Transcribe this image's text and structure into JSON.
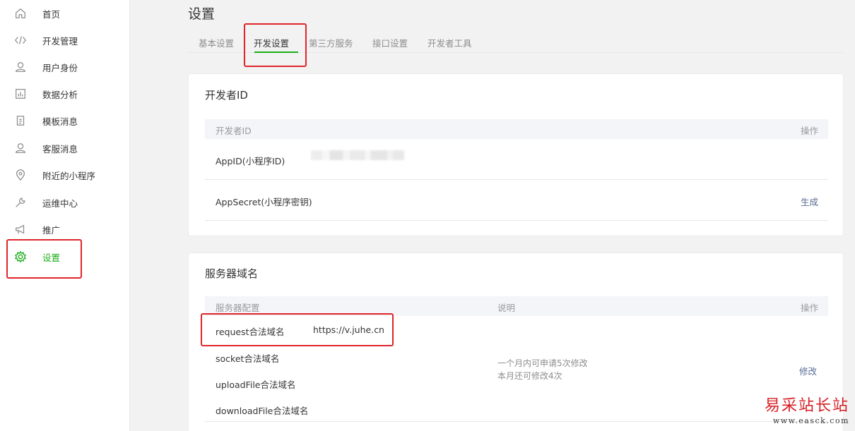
{
  "sidebar": {
    "items": [
      {
        "label": "首页",
        "icon": "home-icon"
      },
      {
        "label": "开发管理",
        "icon": "code-icon"
      },
      {
        "label": "用户身份",
        "icon": "user-icon"
      },
      {
        "label": "数据分析",
        "icon": "chart-icon"
      },
      {
        "label": "模板消息",
        "icon": "document-icon"
      },
      {
        "label": "客服消息",
        "icon": "customer-service-icon"
      },
      {
        "label": "附近的小程序",
        "icon": "location-icon"
      },
      {
        "label": "运维中心",
        "icon": "wrench-icon"
      },
      {
        "label": "推广",
        "icon": "megaphone-icon"
      },
      {
        "label": "设置",
        "icon": "gear-icon"
      }
    ],
    "active_index": 9,
    "active_color": "#1aad19"
  },
  "header": {
    "title": "设置",
    "tabs": [
      "基本设置",
      "开发设置",
      "第三方服务",
      "接口设置",
      "开发者工具"
    ],
    "active_tab": 1
  },
  "developer_card": {
    "title": "开发者ID",
    "table_header": {
      "col1": "开发者ID",
      "col_action": "操作"
    },
    "rows": [
      {
        "key": "AppID(小程序ID)",
        "value_obscured": true
      },
      {
        "key": "AppSecret(小程序密钥)",
        "action": "生成"
      }
    ]
  },
  "server_card": {
    "title": "服务器域名",
    "table_header": {
      "col1": "服务器配置",
      "col2": "说明",
      "col_action": "操作"
    },
    "rows": [
      {
        "key": "request合法域名",
        "value": "https://v.juhe.cn"
      },
      {
        "key": "socket合法域名",
        "value": ""
      },
      {
        "key": "uploadFile合法域名",
        "value": ""
      },
      {
        "key": "downloadFile合法域名",
        "value": ""
      }
    ],
    "description": [
      "一个月内可申请5次修改",
      "本月还可修改4次"
    ],
    "action": "修改"
  },
  "watermark": {
    "cn": "易采站长站",
    "url": "www.easck.com"
  },
  "colors": {
    "accent": "#1aad19",
    "link": "#576b95",
    "highlight": "#e0242a"
  }
}
